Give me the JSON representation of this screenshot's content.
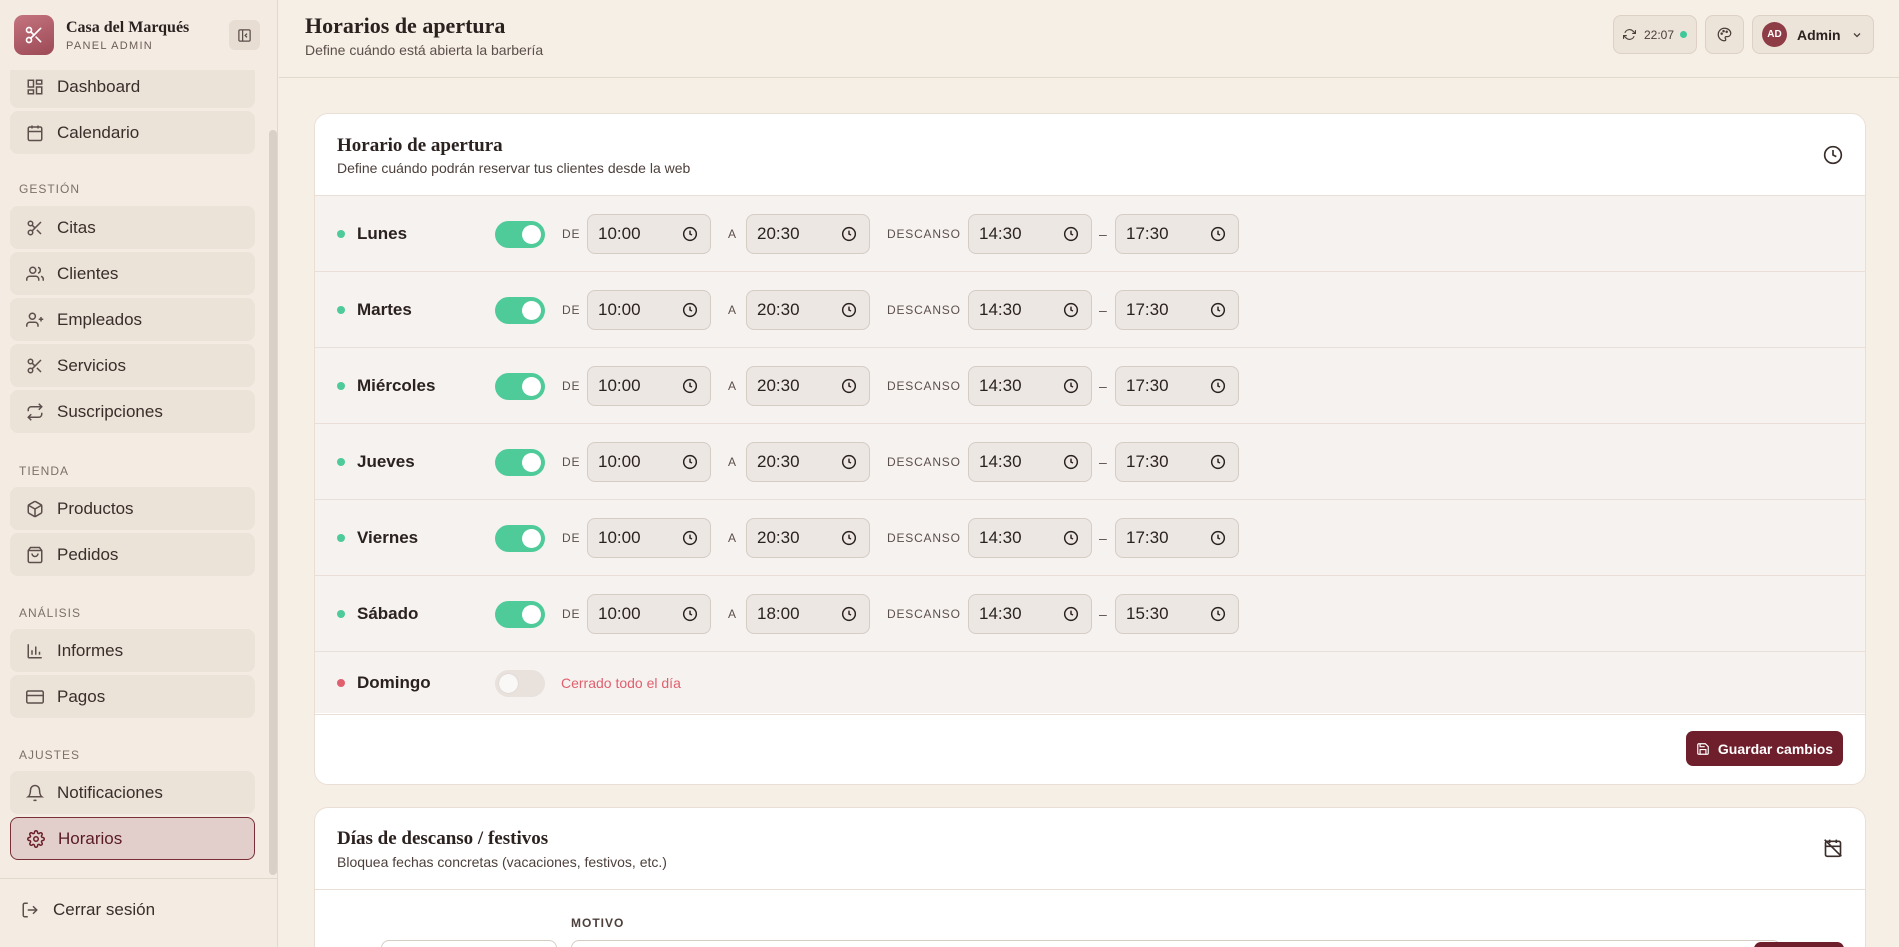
{
  "brand": {
    "name": "Casa del Marqués",
    "subtitle": "PANEL ADMIN"
  },
  "nav": {
    "top_items": [
      {
        "label": "Dashboard",
        "icon": "dashboard-icon"
      },
      {
        "label": "Calendario",
        "icon": "calendar-icon"
      }
    ],
    "sections": [
      {
        "label": "GESTIÓN",
        "items": [
          {
            "label": "Citas",
            "icon": "scissors-icon"
          },
          {
            "label": "Clientes",
            "icon": "users-icon"
          },
          {
            "label": "Empleados",
            "icon": "user-plus-icon"
          },
          {
            "label": "Servicios",
            "icon": "scissors-icon"
          },
          {
            "label": "Suscripciones",
            "icon": "repeat-icon"
          }
        ]
      },
      {
        "label": "TIENDA",
        "items": [
          {
            "label": "Productos",
            "icon": "package-icon"
          },
          {
            "label": "Pedidos",
            "icon": "shopping-bag-icon"
          }
        ]
      },
      {
        "label": "ANÁLISIS",
        "items": [
          {
            "label": "Informes",
            "icon": "bar-chart-icon"
          },
          {
            "label": "Pagos",
            "icon": "credit-card-icon"
          }
        ]
      },
      {
        "label": "AJUSTES",
        "items": [
          {
            "label": "Notificaciones",
            "icon": "bell-icon"
          },
          {
            "label": "Horarios",
            "icon": "gear-icon",
            "active": true
          }
        ]
      }
    ],
    "logout_label": "Cerrar sesión"
  },
  "header": {
    "title": "Horarios de apertura",
    "subtitle": "Define cuándo está abierta la barbería",
    "sync_time": "22:07",
    "user_initials": "AD",
    "user_name": "Admin"
  },
  "schedule_card": {
    "title": "Horario de apertura",
    "subtitle": "Define cuándo podrán reservar tus clientes desde la web",
    "label_from": "DE",
    "label_to": "A",
    "label_break": "DESCANSO",
    "separator": "–",
    "closed_text": "Cerrado todo el día",
    "save_label": "Guardar cambios",
    "days": [
      {
        "name": "Lunes",
        "open": true,
        "from": "10:00",
        "to": "20:30",
        "break_from": "14:30",
        "break_to": "17:30"
      },
      {
        "name": "Martes",
        "open": true,
        "from": "10:00",
        "to": "20:30",
        "break_from": "14:30",
        "break_to": "17:30"
      },
      {
        "name": "Miércoles",
        "open": true,
        "from": "10:00",
        "to": "20:30",
        "break_from": "14:30",
        "break_to": "17:30"
      },
      {
        "name": "Jueves",
        "open": true,
        "from": "10:00",
        "to": "20:30",
        "break_from": "14:30",
        "break_to": "17:30"
      },
      {
        "name": "Viernes",
        "open": true,
        "from": "10:00",
        "to": "20:30",
        "break_from": "14:30",
        "break_to": "17:30"
      },
      {
        "name": "Sábado",
        "open": true,
        "from": "10:00",
        "to": "18:00",
        "break_from": "14:30",
        "break_to": "15:30"
      },
      {
        "name": "Domingo",
        "open": false
      }
    ]
  },
  "holidays_card": {
    "title": "Días de descanso / festivos",
    "subtitle": "Bloquea fechas concretas (vacaciones, festivos, etc.)",
    "motivo_label": "MOTIVO"
  },
  "colors": {
    "accent": "#6e1f2b",
    "open": "#4ecb98",
    "closed": "#e0606f"
  }
}
